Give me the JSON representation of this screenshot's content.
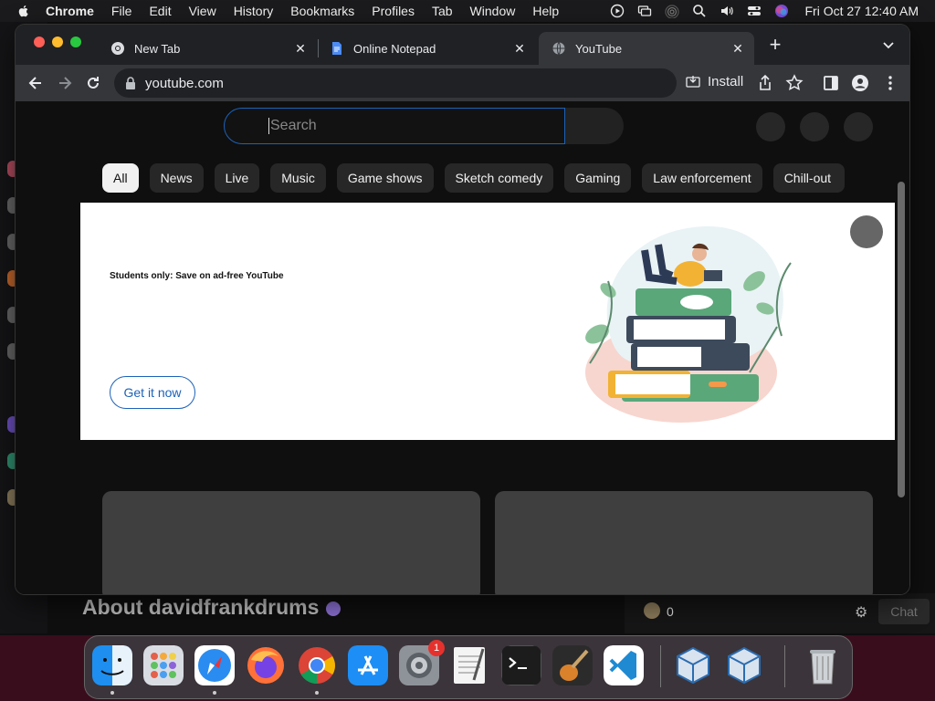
{
  "menubar": {
    "app_name": "Chrome",
    "menus": [
      "File",
      "Edit",
      "View",
      "History",
      "Bookmarks",
      "Profiles",
      "Tab",
      "Window",
      "Help"
    ],
    "clock": "Fri Oct 27  12:40 AM"
  },
  "browser": {
    "tabs": [
      {
        "title": "New Tab",
        "favicon": "chrome-icon"
      },
      {
        "title": "Online Notepad",
        "favicon": "document-icon"
      },
      {
        "title": "YouTube",
        "favicon": "globe-icon"
      }
    ],
    "active_tab": 2,
    "url": "youtube.com",
    "install_label": "Install"
  },
  "youtube": {
    "search_placeholder": "Search",
    "chips": [
      "All",
      "News",
      "Live",
      "Music",
      "Game shows",
      "Sketch comedy",
      "Gaming",
      "Law enforcement",
      "Chill-out"
    ],
    "selected_chip": "All",
    "banner": {
      "text": "Students only: Save on ad-free YouTube",
      "button_label": "Get it now"
    }
  },
  "background_page": {
    "channel_title": "About davidfrankdrums",
    "viewer_count": "0",
    "chat_label": "Chat"
  },
  "dock": {
    "apps": [
      "finder-icon",
      "launchpad-icon",
      "safari-icon",
      "firefox-icon",
      "chrome-icon",
      "app-store-icon",
      "system-settings-icon",
      "textedit-icon",
      "terminal-icon",
      "garageband-icon",
      "vscode-icon",
      "virtualbox-icon",
      "virtualbox-icon",
      "trash-icon"
    ],
    "settings_badge": "1"
  },
  "colors": {
    "accent": "#1c62b9",
    "chrome_dark": "#202124",
    "youtube_bg": "#0f0f0f"
  }
}
